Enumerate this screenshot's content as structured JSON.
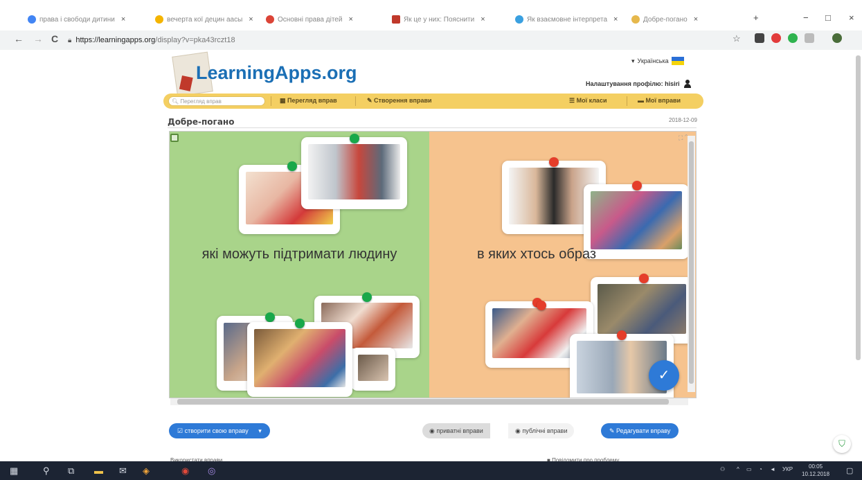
{
  "browser": {
    "tabs": [
      {
        "label": "права і свободи дитини",
        "color": "#4285f4"
      },
      {
        "label": "вечерта кої децин аасы",
        "color": "#f4b400"
      },
      {
        "label": "Основні права дітей",
        "color": "#db4437"
      },
      {
        "label": "Як це у них: Пояснити",
        "color": "#c0392b"
      },
      {
        "label": "Як взаємовне інтерпрета",
        "color": "#3aa0e0"
      },
      {
        "label": "Добре-погано",
        "color": "#e6b84c"
      }
    ],
    "new_tab": "+",
    "win_min": "−",
    "win_max": "□",
    "win_close": "×",
    "back": "←",
    "forward": "→",
    "reload": "C",
    "url_host": "https://learningapps.org",
    "url_path": "/display?v=pka43rczt18",
    "star": "☆"
  },
  "site": {
    "logo": "LearningApps.org",
    "language": "Українська",
    "profile": "Налаштування профілю: hisiri",
    "search_placeholder": "Перегляд вправ",
    "nav": {
      "browse": "Перегляд вправ",
      "create": "Створення вправи",
      "classes": "Мої класи",
      "my_apps": "Мої вправи"
    },
    "page_title": "Добре-погано",
    "date": "2018-12-09"
  },
  "exercise": {
    "left_caption": "які можуть підтримати людину",
    "right_caption": "в яких хтось образ",
    "colors": {
      "left": "#a9d48a",
      "right": "#f6c38e",
      "pin_green": "#18a84a",
      "pin_red": "#e53d2a"
    }
  },
  "actions": {
    "create_own": "створити свою вправу",
    "private": "приватні вправи",
    "public": "публічні вправи",
    "edit": "Редагувати вправу",
    "below_left": "Використати вправи",
    "below_right": "Повідомити про проблему"
  },
  "taskbar": {
    "lang": "УКР",
    "time": "00:05",
    "date": "10.12.2018"
  }
}
